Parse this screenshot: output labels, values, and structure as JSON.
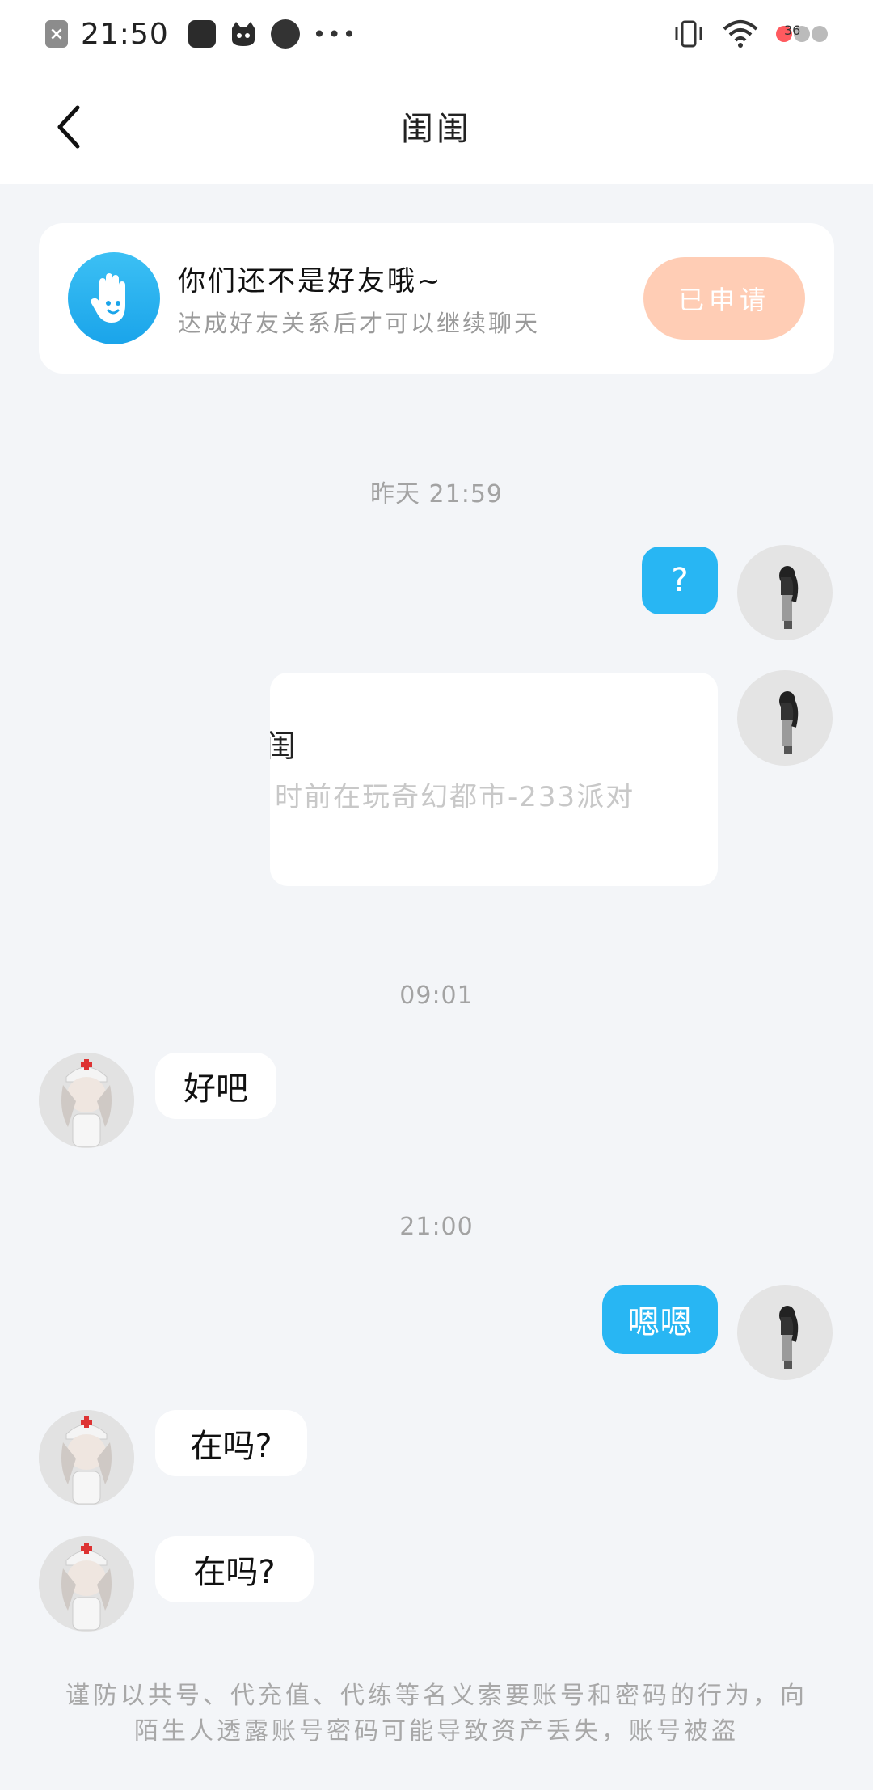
{
  "status_bar": {
    "time": "21:50",
    "more": "•••",
    "battery_level": "36"
  },
  "nav": {
    "title": "闺闺"
  },
  "friend_banner": {
    "title": "你们还不是好友哦~",
    "subtitle": "达成好友关系后才可以继续聊天",
    "button_label": "已申请"
  },
  "messages": {
    "ts1": "昨天 21:59",
    "m1": "?",
    "card_title": "闺",
    "card_subtitle": "时前在玩奇幻都市-233派对",
    "ts2": "09:01",
    "m2": "好吧",
    "ts3": "21:00",
    "m3": "嗯嗯",
    "m4": "在吗?",
    "m5": "在吗?"
  },
  "footer": {
    "warning": "谨防以共号、代充值、代练等名义索要账号和密码的行为，向陌生人透露账号密码可能导致资产丢失，账号被盗"
  },
  "colors": {
    "accent_blue": "#28b6f3",
    "applied_button": "#ffcdb5",
    "background": "#f3f5f8"
  }
}
